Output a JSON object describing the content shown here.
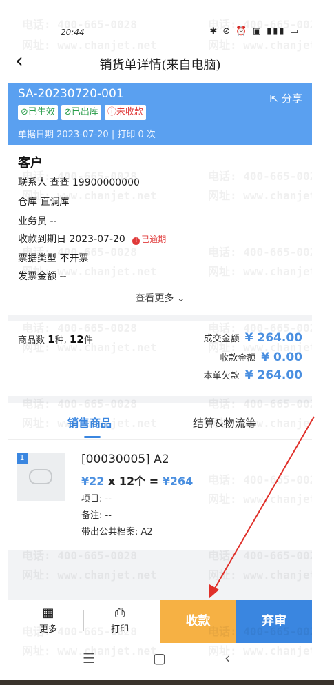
{
  "status_bar": {
    "time": "20:44",
    "icons": "✱ ⊘ ⏰ ▣ ▮▮▮ ▭"
  },
  "header": {
    "back_icon": "chevron-left-icon",
    "title": "销货单详情(来自电脑)"
  },
  "document": {
    "number": "SA-20230720-001",
    "share_label": "分享",
    "badges": [
      {
        "label": "已生效",
        "icon": "check-circle-icon"
      },
      {
        "label": "已出库",
        "icon": "check-circle-icon"
      },
      {
        "label": "未收款",
        "icon": "alert-circle-icon"
      }
    ],
    "date_line": "单据日期 2023-07-20 | 打印 0 次"
  },
  "customer": {
    "heading": "客户",
    "rows": [
      {
        "label": "联系人",
        "value": "查查 19900000000"
      },
      {
        "label": "仓库",
        "value": "直调库"
      },
      {
        "label": "业务员",
        "value": "--"
      },
      {
        "label": "收款到期日",
        "value": "2023-07-20",
        "badge": "已逾期"
      },
      {
        "label": "票据类型",
        "value": "不开票"
      },
      {
        "label": "发票金额",
        "value": "--"
      }
    ],
    "more_label": "查看更多"
  },
  "summary": {
    "goods_count_label": "商品数",
    "kinds": "1",
    "kinds_unit": "种,",
    "pieces": "12",
    "pieces_unit": "件",
    "deal_label": "成交金额",
    "deal_amount": "¥ 264.00",
    "received_label": "收款金额",
    "received_amount": "¥ 0.00",
    "owed_label": "本单欠款",
    "owed_amount": "¥ 264.00"
  },
  "tabs": [
    {
      "label": "销售商品",
      "active": true
    },
    {
      "label": "结算&物流等",
      "active": false
    }
  ],
  "product": {
    "index": "1",
    "name": "[00030005] A2",
    "unit_price": "¥22",
    "qty_expr": " x 12个 = ",
    "total": "¥264",
    "project": "项目: --",
    "remark": "备注: --",
    "archive": "带出公共档案: A2"
  },
  "bottom_bar": {
    "more_label": "更多",
    "print_label": "打印",
    "pay_label": "收款",
    "abandon_label": "弃审"
  },
  "watermark": {
    "phone": "电话: 400-665-0028",
    "site": "网址: www.chanjet.net"
  },
  "colors": {
    "primary_blue": "#3a86e0",
    "header_blue": "#5aa0f0",
    "orange": "#f6b144",
    "red": "#e03a3a",
    "green": "#2a9d4a"
  }
}
